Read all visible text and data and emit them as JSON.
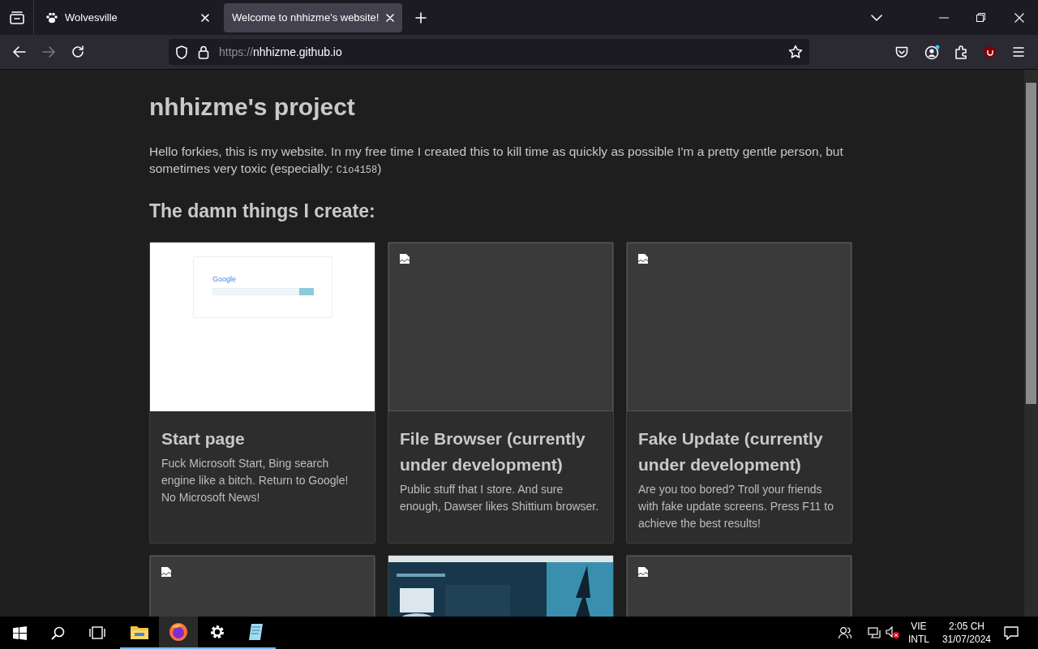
{
  "tabs": [
    {
      "title": "Wolvesville",
      "selected": false
    },
    {
      "title": "Welcome to nhhizme's website!",
      "selected": true
    }
  ],
  "address": {
    "scheme": "https://",
    "host": "nhhizme.github.io"
  },
  "page": {
    "heading": "nhhizme's project",
    "intro": {
      "text": "Hello forkies, this is my website. In my free time I created this to kill time as quickly as possible I'm a pretty gentle person, but sometimes very toxic (especially: ",
      "code": "Cio4158",
      "end": ")"
    },
    "subheading": "The damn things I create:",
    "cards": [
      {
        "kind": "google",
        "thumb_text": "Google",
        "title": "Start page",
        "description": "Fuck Microsoft Start, Bing search engine like a bitch. Return to Google! No Microsoft News!"
      },
      {
        "kind": "broken",
        "title": "File Browser (currently under development)",
        "description": "Public stuff that I store. And sure enough, Dawser likes Shittium browser."
      },
      {
        "kind": "broken",
        "title": "Fake Update (currently under development)",
        "description": "Are you too bored? Troll your friends with fake update screens. Press F11 to achieve the best results!"
      },
      {
        "kind": "broken"
      },
      {
        "kind": "picture"
      },
      {
        "kind": "broken"
      }
    ]
  },
  "taskbar": {
    "apps": [
      {
        "kind": "folder",
        "selected": false
      },
      {
        "kind": "firefox",
        "selected": true
      },
      {
        "kind": "settings",
        "selected": false
      },
      {
        "kind": "notepad",
        "selected": false
      }
    ],
    "language": [
      "VIE",
      "INTL"
    ],
    "time": "2:05 CH",
    "date": "31/07/2024"
  }
}
